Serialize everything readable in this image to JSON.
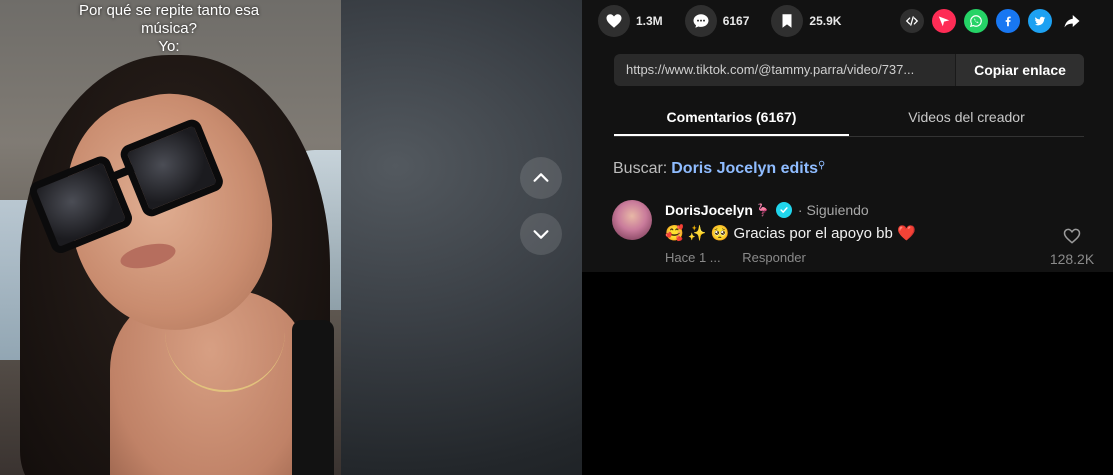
{
  "video": {
    "caption_lines": [
      "Por qué se repite tanto esa",
      "música?",
      "Yo:"
    ]
  },
  "navigation": {
    "up_icon": "chevron-up-icon",
    "down_icon": "chevron-down-icon"
  },
  "actions": {
    "likes": "1.3M",
    "comments": "6167",
    "saves": "25.9K"
  },
  "share": {
    "icons": [
      "embed-icon",
      "send-icon",
      "whatsapp-icon",
      "facebook-icon",
      "twitter-icon",
      "share-arrow-icon"
    ],
    "colors": {
      "send": "#fe2c55",
      "whatsapp": "#25d366",
      "facebook": "#1877f2",
      "twitter": "#1da1f2"
    }
  },
  "link": {
    "url": "https://www.tiktok.com/@tammy.parra/video/737...",
    "copy_label": "Copiar enlace"
  },
  "tabs": [
    {
      "label": "Comentarios (6167)",
      "active": true
    },
    {
      "label": "Videos del creador",
      "active": false
    }
  ],
  "search": {
    "prefix": "Buscar:",
    "term": "Doris Jocelyn edits"
  },
  "comment": {
    "username": "DorisJocelyn",
    "flag": "🦩",
    "following_label": "· Siguiendo",
    "text": "🥰 ✨ 🥺 Gracias por el apoyo bb ❤️",
    "time": "Hace 1 ...",
    "reply_label": "Responder",
    "likes": "128.2K"
  }
}
